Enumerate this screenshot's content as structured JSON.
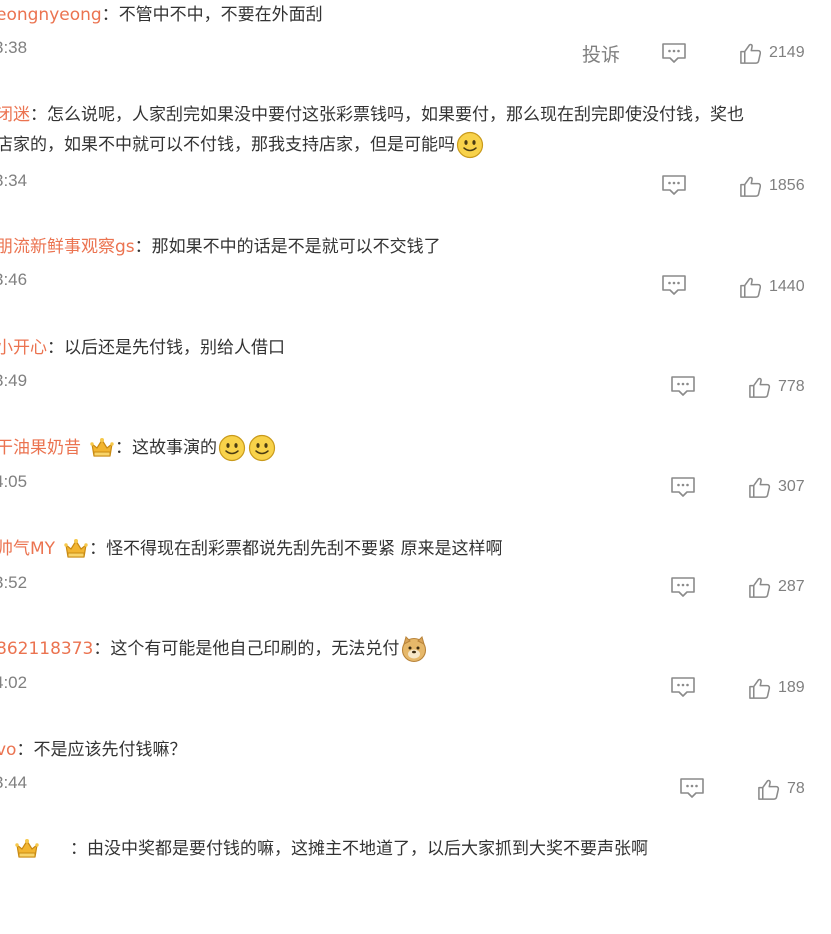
{
  "actions": {
    "report_label": "投诉"
  },
  "comments": [
    {
      "user": "eongnyeong",
      "text": "不管中不中，不要在外面刮",
      "time": "3:38",
      "likes": "2149"
    },
    {
      "user": "闭迷",
      "text": "怎么说呢，人家刮完如果没中要付这张彩票钱吗，如果要付，那么现在刮完即使没付钱，奖也",
      "text2": "店家的，如果不中就可以不付钱，那我支持店家，但是可能吗",
      "time": "3:34",
      "likes": "1856"
    },
    {
      "user": "朋流新鲜事观察gs",
      "text": "那如果不中的话是不是就可以不交钱了",
      "time": "3:46",
      "likes": "1440"
    },
    {
      "user": "小开心",
      "text": "以后还是先付钱，别给人借口",
      "time": "3:49",
      "likes": "778"
    },
    {
      "user": "干油果奶昔",
      "text": "这故事演的",
      "time": "4:05",
      "likes": "307"
    },
    {
      "user": "帅气MY",
      "text": "怪不得现在刮彩票都说先刮先刮不要紧 原来是这样啊",
      "time": "3:52",
      "likes": "287"
    },
    {
      "user": "862118373",
      "text": "这个有可能是他自己印刷的，无法兑付",
      "time": "4:02",
      "likes": "189"
    },
    {
      "user": "vo",
      "text": "不是应该先付钱嘛？",
      "time": "3:44",
      "likes": "78"
    },
    {
      "text": "由没中奖都是要付钱的嘛，这摊主不地道了，以后大家抓到大奖不要声张啊"
    }
  ]
}
